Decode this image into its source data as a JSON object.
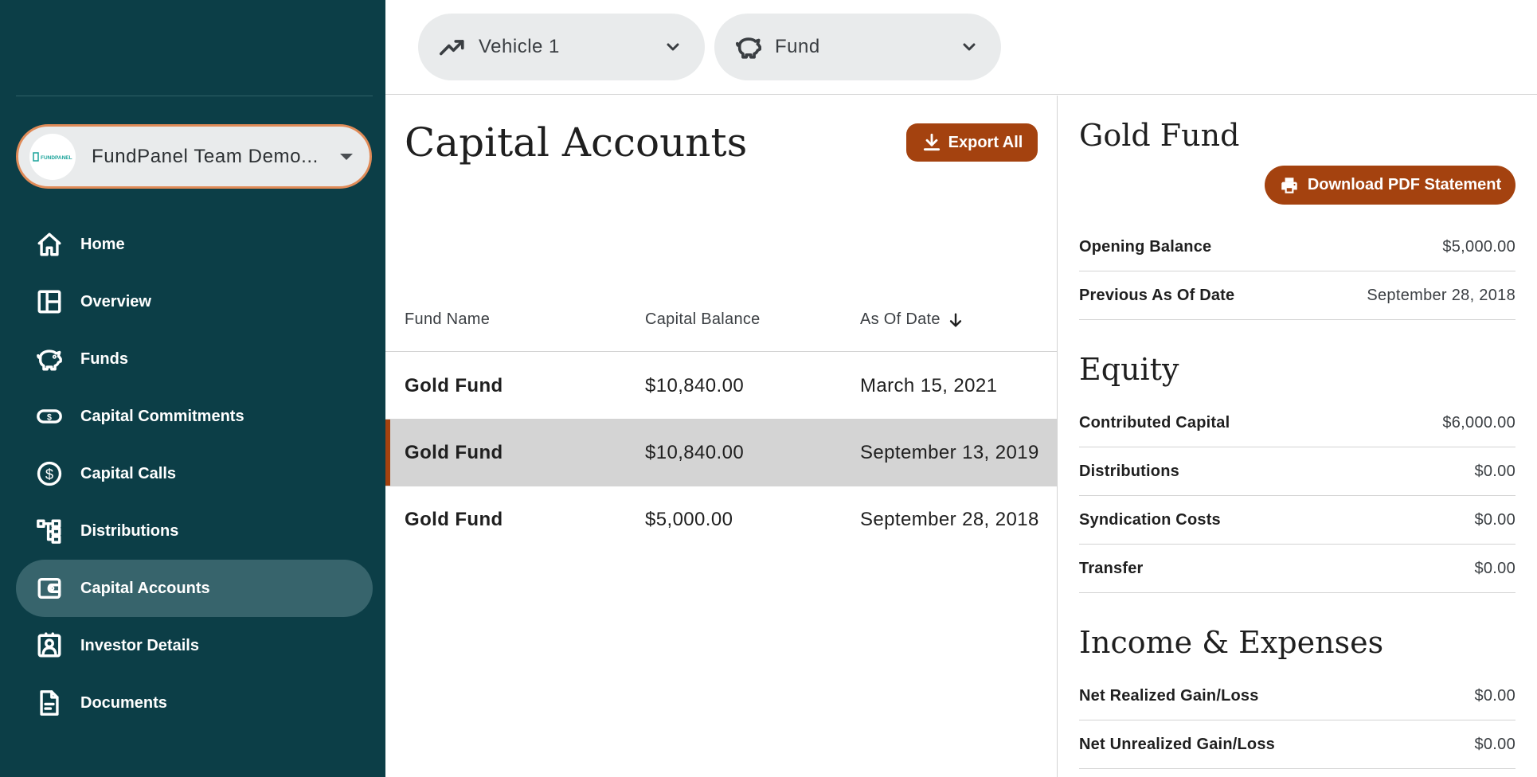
{
  "sidebar": {
    "org": {
      "label": "FundPanel Team Demo...",
      "logo_text": "FUNDPANEL"
    },
    "items": [
      {
        "label": "Home",
        "icon": "home-icon"
      },
      {
        "label": "Overview",
        "icon": "layout-icon"
      },
      {
        "label": "Funds",
        "icon": "piggy-bank-icon"
      },
      {
        "label": "Capital Commitments",
        "icon": "money-pill-icon"
      },
      {
        "label": "Capital Calls",
        "icon": "dollar-circle-icon"
      },
      {
        "label": "Distributions",
        "icon": "hierarchy-icon"
      },
      {
        "label": "Capital Accounts",
        "icon": "wallet-icon",
        "active": true
      },
      {
        "label": "Investor Details",
        "icon": "contact-card-icon"
      },
      {
        "label": "Documents",
        "icon": "document-icon"
      }
    ]
  },
  "filters": {
    "vehicle": {
      "label": "Vehicle 1",
      "icon": "trending-up-icon"
    },
    "fund": {
      "label": "Fund",
      "icon": "piggy-bank-icon"
    }
  },
  "main": {
    "title": "Capital Accounts",
    "export_label": "Export All",
    "columns": [
      "Fund Name",
      "Capital Balance",
      "As Of Date"
    ],
    "rows": [
      {
        "fund": "Gold Fund",
        "balance": "$10,840.00",
        "date": "March 15, 2021"
      },
      {
        "fund": "Gold Fund",
        "balance": "$10,840.00",
        "date": "September 13, 2019",
        "selected": true
      },
      {
        "fund": "Gold Fund",
        "balance": "$5,000.00",
        "date": "September 28, 2018"
      }
    ]
  },
  "detail": {
    "title": "Gold Fund",
    "download_label": "Download PDF Statement",
    "summary": [
      {
        "label": "Opening Balance",
        "value": "$5,000.00"
      },
      {
        "label": "Previous As Of Date",
        "value": "September 28, 2018"
      }
    ],
    "equity_title": "Equity",
    "equity": [
      {
        "label": "Contributed Capital",
        "value": "$6,000.00"
      },
      {
        "label": "Distributions",
        "value": "$0.00"
      },
      {
        "label": "Syndication Costs",
        "value": "$0.00"
      },
      {
        "label": "Transfer",
        "value": "$0.00"
      }
    ],
    "income_title": "Income & Expenses",
    "income": [
      {
        "label": "Net Realized Gain/Loss",
        "value": "$0.00"
      },
      {
        "label": "Net Unrealized Gain/Loss",
        "value": "$0.00"
      }
    ]
  },
  "colors": {
    "sidebar": "#0c3e47",
    "active_item": "#37646c",
    "accent": "#a4420f",
    "org_border": "#e08b58"
  }
}
